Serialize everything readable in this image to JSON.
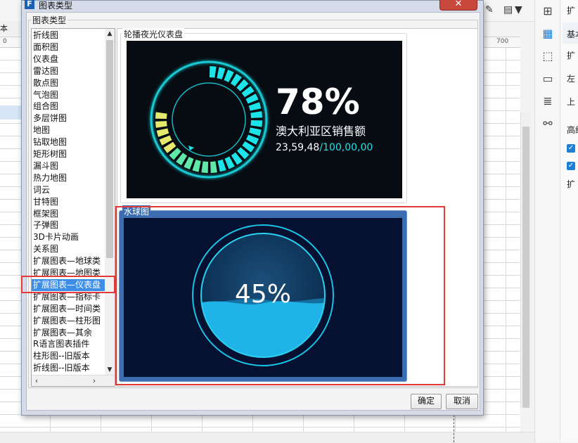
{
  "background": {
    "left_tab_text": "本",
    "ruler_start": "0",
    "ruler_mark": "700",
    "rail_icons": [
      "layout-icon",
      "component-icon",
      "crop-icon",
      "widget-icon",
      "data-icon",
      "link-icon"
    ],
    "panel_labels": [
      "基本",
      "扩",
      "左",
      "上",
      "高级",
      "扩"
    ],
    "panel_top_label": "扩"
  },
  "dialog": {
    "title": "图表类型",
    "close_symbol": "✕",
    "group_label": "图表类型",
    "chart_types": [
      "折线图",
      "面积图",
      "仪表盘",
      "雷达图",
      "散点图",
      "气泡图",
      "组合图",
      "多层饼图",
      "地图",
      "钻取地图",
      "矩形树图",
      "漏斗图",
      "热力地图",
      "词云",
      "甘特图",
      "框架图",
      "子弹图",
      "3D卡片动画",
      "关系图",
      "扩展图表—地球类",
      "扩展图表—地图类",
      "扩展图表—仪表盘",
      "扩展图表—指标卡",
      "扩展图表—时间类",
      "扩展图表—柱形图",
      "扩展图表—其余",
      "R语言图表插件",
      "柱形图--旧版本",
      "折线图--旧版本"
    ],
    "selected_index": 21,
    "previews": [
      {
        "label": "轮播夜光仪表盘",
        "percent": "78%",
        "caption": "澳大利亚区销售额",
        "value": "23,59,48",
        "total": "/100,00,00",
        "progress": 0.78
      },
      {
        "label": "水球图",
        "percent": "45%",
        "fill_level": 0.45
      }
    ],
    "ok_label": "确定",
    "cancel_label": "取消"
  },
  "colors": {
    "selection": "#3d8ee6",
    "highlight": "#e03a3a",
    "gauge_cyan": "#1de4e8",
    "water_blue": "#1fb3e8"
  }
}
